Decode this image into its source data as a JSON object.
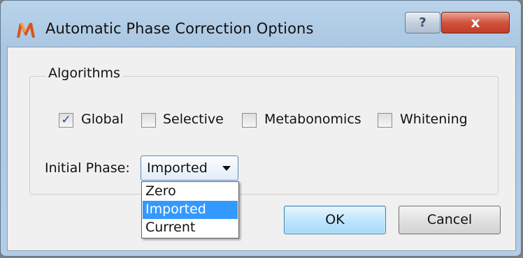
{
  "window": {
    "title": "Automatic Phase Correction Options",
    "help_label": "?",
    "close_label": "x"
  },
  "algorithms": {
    "group_title": "Algorithms",
    "options": [
      {
        "label": "Global",
        "checked": true
      },
      {
        "label": "Selective",
        "checked": false
      },
      {
        "label": "Metabonomics",
        "checked": false
      },
      {
        "label": "Whitening",
        "checked": false
      }
    ]
  },
  "initial_phase": {
    "label": "Initial Phase:",
    "selected": "Imported",
    "options": [
      "Zero",
      "Imported",
      "Current"
    ]
  },
  "buttons": {
    "ok": "OK",
    "cancel": "Cancel"
  },
  "colors": {
    "titlebar": "#a9c6e1",
    "close": "#c13d28",
    "selection": "#3399ff"
  },
  "icons": {
    "app": "app-logo-icon",
    "checkmark": "checkmark-icon",
    "dropdown": "dropdown-arrow-icon"
  }
}
